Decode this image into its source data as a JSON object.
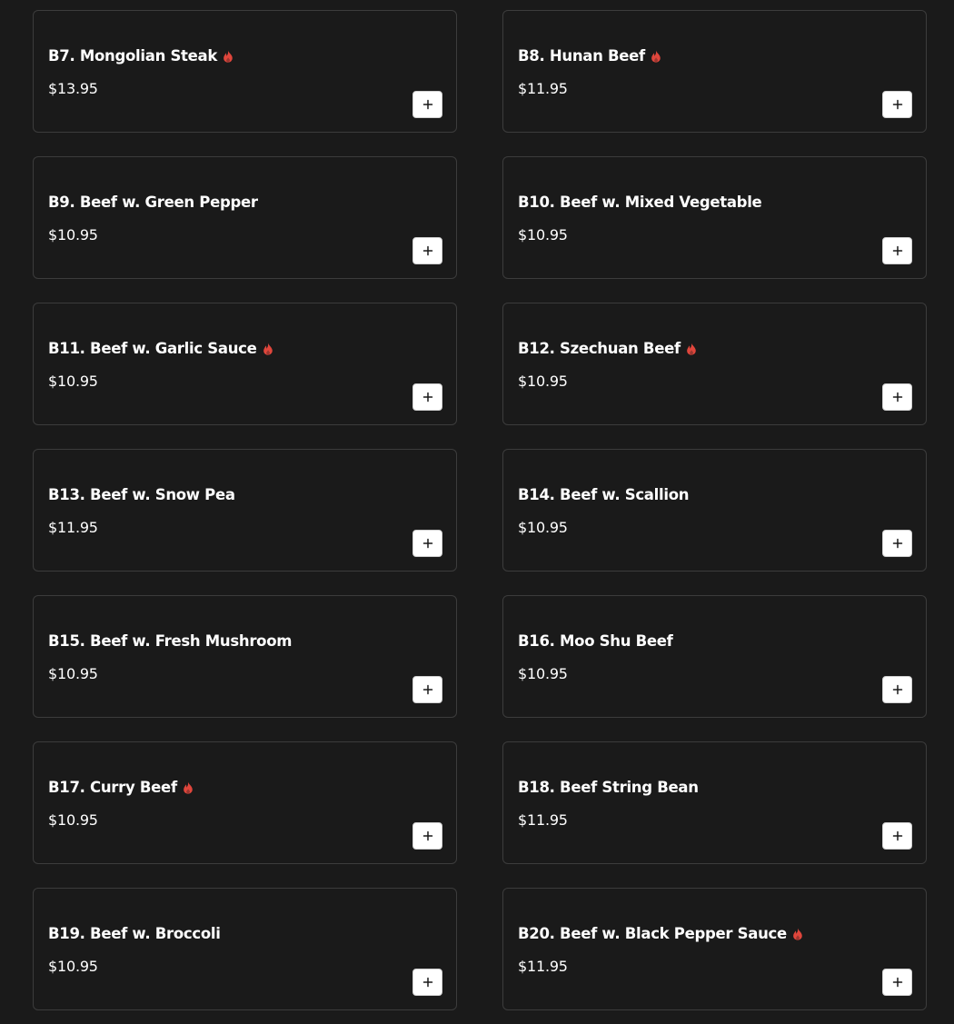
{
  "menu": {
    "items": [
      {
        "name": "B7. Mongolian Steak",
        "price": "$13.95",
        "spicy": true
      },
      {
        "name": "B8. Hunan Beef",
        "price": "$11.95",
        "spicy": true
      },
      {
        "name": "B9. Beef w. Green Pepper",
        "price": "$10.95",
        "spicy": false
      },
      {
        "name": "B10. Beef w. Mixed Vegetable",
        "price": "$10.95",
        "spicy": false
      },
      {
        "name": "B11. Beef w. Garlic Sauce",
        "price": "$10.95",
        "spicy": true
      },
      {
        "name": "B12. Szechuan Beef",
        "price": "$10.95",
        "spicy": true
      },
      {
        "name": "B13. Beef w. Snow Pea",
        "price": "$11.95",
        "spicy": false
      },
      {
        "name": "B14. Beef w. Scallion",
        "price": "$10.95",
        "spicy": false
      },
      {
        "name": "B15. Beef w. Fresh Mushroom",
        "price": "$10.95",
        "spicy": false
      },
      {
        "name": "B16. Moo Shu Beef",
        "price": "$10.95",
        "spicy": false
      },
      {
        "name": "B17. Curry Beef",
        "price": "$10.95",
        "spicy": true
      },
      {
        "name": "B18. Beef String Bean",
        "price": "$11.95",
        "spicy": false
      },
      {
        "name": "B19. Beef w. Broccoli",
        "price": "$10.95",
        "spicy": false
      },
      {
        "name": "B20. Beef w. Black Pepper Sauce",
        "price": "$11.95",
        "spicy": true
      }
    ]
  },
  "icons": {
    "spicy": "flame-icon",
    "add": "plus-icon"
  },
  "colors": {
    "background": "#1a1a1a",
    "card_border": "#3c3c3c",
    "text": "#ffffff",
    "spicy": "#e0463c",
    "button_bg": "#ffffff"
  }
}
